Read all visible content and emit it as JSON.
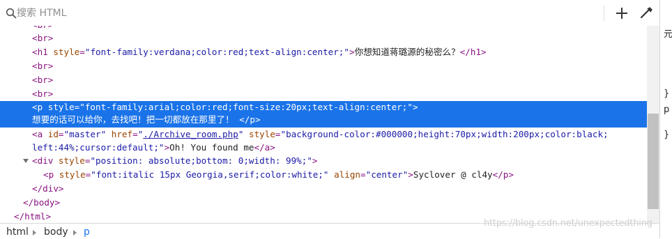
{
  "search": {
    "placeholder": "搜索 HTML",
    "value": ""
  },
  "toolbar": {
    "add_node_icon": "plus-icon",
    "eyedropper_icon": "eyedropper-icon"
  },
  "code": {
    "br": "<br>",
    "h1_open": "<h1 ",
    "h1_attr": "style",
    "h1_eq": "=\"",
    "h1_val": "font-family:verdana;color:red;text-align:center;",
    "h1_close_q": "\">",
    "h1_text": "你想知道蒋璐源的秘密么？",
    "h1_end": "</h1>",
    "p_open": "<p ",
    "p_attr": "style",
    "p_val": "font-family:arial;color:red;font-size:20px;text-align:center;",
    "p_text": "想要的话可以给你，去找吧！把一切都放在那里了！",
    "p_end": "</p>",
    "a_open": "<a ",
    "a_id_attr": "id",
    "a_id_val": "master",
    "a_href_attr": "href",
    "a_href_val": "./Archive_room.php",
    "a_style_attr": "style",
    "a_style_val_1": "background-color:#000000;height:70px;width:200px;color:black;",
    "a_style_val_2": "left:44%;cursor:default;",
    "a_text": "Oh! You found me",
    "a_end": "</a>",
    "div_open": "<div ",
    "div_attr": "style",
    "div_val": "position: absolute;bottom: 0;width: 99%;",
    "p2_style_val": "font:italic 15px Georgia,serif;color:white;",
    "p2_align_attr": "align",
    "p2_align_val": "center",
    "p2_text": "Syclover @ cl4y",
    "div_end": "</div>",
    "body_end": "</body>",
    "html_end": "</html>"
  },
  "side_panel": {
    "line1": "元",
    "line2": "}",
    "line3": "p",
    "line4": "}"
  },
  "breadcrumb": {
    "items": [
      "html",
      "body",
      "p"
    ]
  },
  "watermark": "https://blog.csdn.net/unexpectedthing",
  "colors": {
    "selection": "#1a73e8",
    "tag": "#881280",
    "attr": "#994500",
    "value": "#1a1aa6"
  }
}
